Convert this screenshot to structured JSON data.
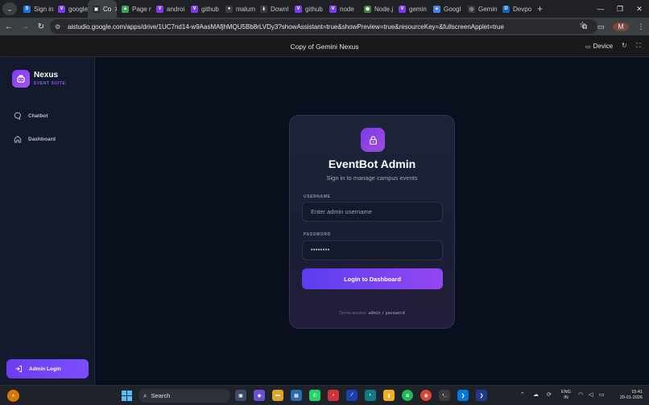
{
  "browser": {
    "tabs": [
      {
        "label": "Sign in",
        "fav_color": "#1a73e8",
        "fav_glyph": "S",
        "active": false
      },
      {
        "label": "google",
        "fav_color": "#7c3aed",
        "fav_glyph": "V",
        "active": false
      },
      {
        "label": "Co",
        "fav_color": "#2b2b2b",
        "fav_glyph": "▣",
        "active": true
      },
      {
        "label": "Page n",
        "fav_color": "#34a853",
        "fav_glyph": "▲",
        "active": false
      },
      {
        "label": "androi",
        "fav_color": "#7c3aed",
        "fav_glyph": "V",
        "active": false
      },
      {
        "label": "github",
        "fav_color": "#7c3aed",
        "fav_glyph": "V",
        "active": false
      },
      {
        "label": "malum",
        "fav_color": "#3c3c3c",
        "fav_glyph": "●",
        "active": false
      },
      {
        "label": "Downl",
        "fav_color": "#3c3c3c",
        "fav_glyph": "⬇",
        "active": false
      },
      {
        "label": "github",
        "fav_color": "#7c3aed",
        "fav_glyph": "V",
        "active": false
      },
      {
        "label": "node",
        "fav_color": "#7c3aed",
        "fav_glyph": "V",
        "active": false
      },
      {
        "label": "Node.j",
        "fav_color": "#3c873a",
        "fav_glyph": "⬢",
        "active": false
      },
      {
        "label": "gemin",
        "fav_color": "#7c3aed",
        "fav_glyph": "V",
        "active": false
      },
      {
        "label": "Googl",
        "fav_color": "#4285f4",
        "fav_glyph": "✦",
        "active": false
      },
      {
        "label": "Gemin",
        "fav_color": "#3c3c3c",
        "fav_glyph": "◎",
        "active": false
      },
      {
        "label": "Devpo",
        "fav_color": "#1565c0",
        "fav_glyph": "D",
        "active": false
      }
    ],
    "close_glyph": "✕",
    "new_tab_glyph": "+",
    "url": "aistudio.google.com/apps/drive/1UC7nd14-w9AasMAfjhMQU5Bb8rLVDy3?showAssistant=true&showPreview=true&resourceKey=&fullscreenApplet=true",
    "profile_initial": "M"
  },
  "app_header": {
    "title": "Copy of Gemini Nexus",
    "device_label": "Device"
  },
  "sidebar": {
    "brand": "Nexus",
    "brand_sub": "EVENT SUITE",
    "nav": [
      {
        "label": "Chatbot",
        "icon": "chat-icon"
      },
      {
        "label": "Dashboard",
        "icon": "home-icon"
      }
    ],
    "admin_button": "Admin Login"
  },
  "login": {
    "title": "EventBot Admin",
    "subtitle": "Sign in to manage campus events",
    "username_label": "USERNAME",
    "username_placeholder": "Enter admin username",
    "password_label": "PASSWORD",
    "password_value": "••••••••",
    "button": "Login to Dashboard",
    "demo_prefix": "Demo access:",
    "demo_user": "admin",
    "demo_sep": "/",
    "demo_pass": "password"
  },
  "taskbar": {
    "search_label": "Search",
    "lang_top": "ENG",
    "lang_bottom": "IN",
    "time": "15:41",
    "date": "20-01-2026"
  },
  "colors": {
    "accent": "#7c3aed",
    "sidebar_bg": "#131a2b",
    "main_bg": "#0a0f1e"
  }
}
